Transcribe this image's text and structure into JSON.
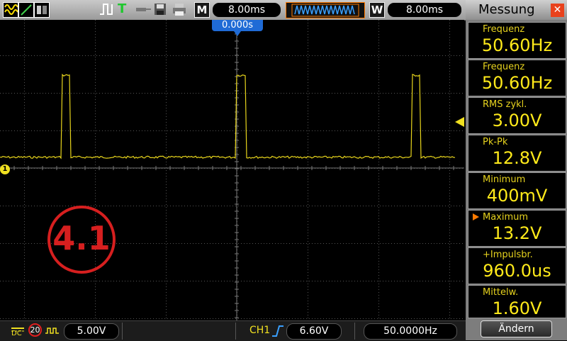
{
  "toolbar": {
    "mode_label": "M",
    "timebase_value": "8.00ms",
    "window_label": "W",
    "window_value": "8.00ms",
    "trigger_position": "0.000s"
  },
  "screen": {
    "channel_marker": "1",
    "overlay_label": "4.1"
  },
  "panel": {
    "title": "Messung",
    "close_glyph": "✕",
    "measurements": [
      {
        "label": "Frequenz",
        "value": "50.60Hz",
        "selected": false
      },
      {
        "label": "Frequenz",
        "value": "50.60Hz",
        "selected": false
      },
      {
        "label": "RMS  zykl.",
        "value": "3.00V",
        "selected": false
      },
      {
        "label": "Pk-Pk",
        "value": "12.8V",
        "selected": false
      },
      {
        "label": "Minimum",
        "value": "400mV",
        "selected": false
      },
      {
        "label": "Maximum",
        "value": "13.2V",
        "selected": true
      },
      {
        "label": "+Impulsbr.",
        "value": "960.0us",
        "selected": false
      },
      {
        "label": "Mittelw.",
        "value": "1.60V",
        "selected": false
      }
    ],
    "change_button": "Ändern"
  },
  "bottombar": {
    "coupling": "DC",
    "bw_limit": "20",
    "volts_div": "5.00V",
    "trigger_source": "CH1",
    "trigger_level": "6.60V",
    "trigger_freq": "50.0000Hz"
  },
  "waveform": {
    "pulse_period_ms": 19.76,
    "pulse_width_us": 960.0,
    "low_level_v": 0.4,
    "high_level_v": 13.2,
    "volts_per_div": 5.0,
    "time_per_div_ms": 8.0
  },
  "colors": {
    "trace": "#e8d51c",
    "grid": "#555555",
    "overlay_red": "#d61f1f",
    "trigger_marker": "#f0e020",
    "accent_orange": "#ff7a00"
  },
  "icons": [
    "waveform-icon",
    "cursor-icon",
    "display-icon",
    "pulse-icon",
    "trigger-icon",
    "probe-icon",
    "save-icon",
    "print-icon"
  ]
}
